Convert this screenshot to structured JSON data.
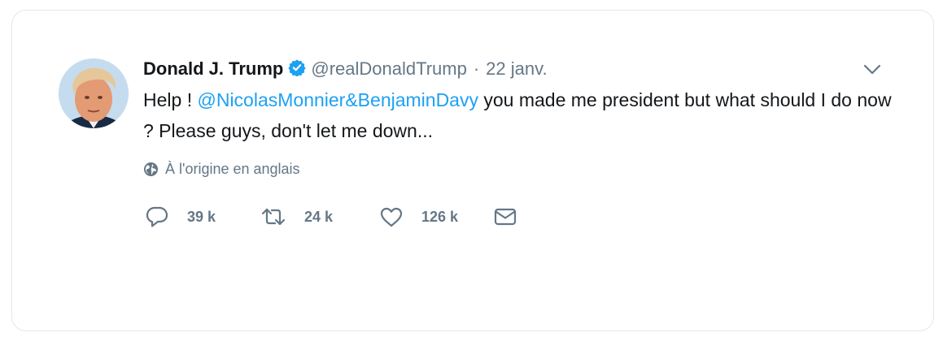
{
  "tweet": {
    "author_name": "Donald J. Trump",
    "handle": "@realDonaldTrump",
    "separator": "·",
    "date": "22 janv.",
    "text_before": "Help ! ",
    "mention": "@NicolasMonnier&BenjaminDavy",
    "text_after": " you made me president but what should I do now ? Please guys, don't let me down...",
    "translation_note": "À l'origine en anglais"
  },
  "actions": {
    "reply_count": "39 k",
    "retweet_count": "24 k",
    "like_count": "126 k"
  },
  "icons": {
    "verified": "verified-badge-icon",
    "menu": "chevron-down-icon",
    "translation": "globe-icon",
    "reply": "reply-icon",
    "retweet": "retweet-icon",
    "like": "heart-icon",
    "message": "envelope-icon"
  },
  "colors": {
    "accent": "#1da1f2",
    "muted": "#657786",
    "text": "#14171a",
    "border": "#e1e8ed"
  }
}
